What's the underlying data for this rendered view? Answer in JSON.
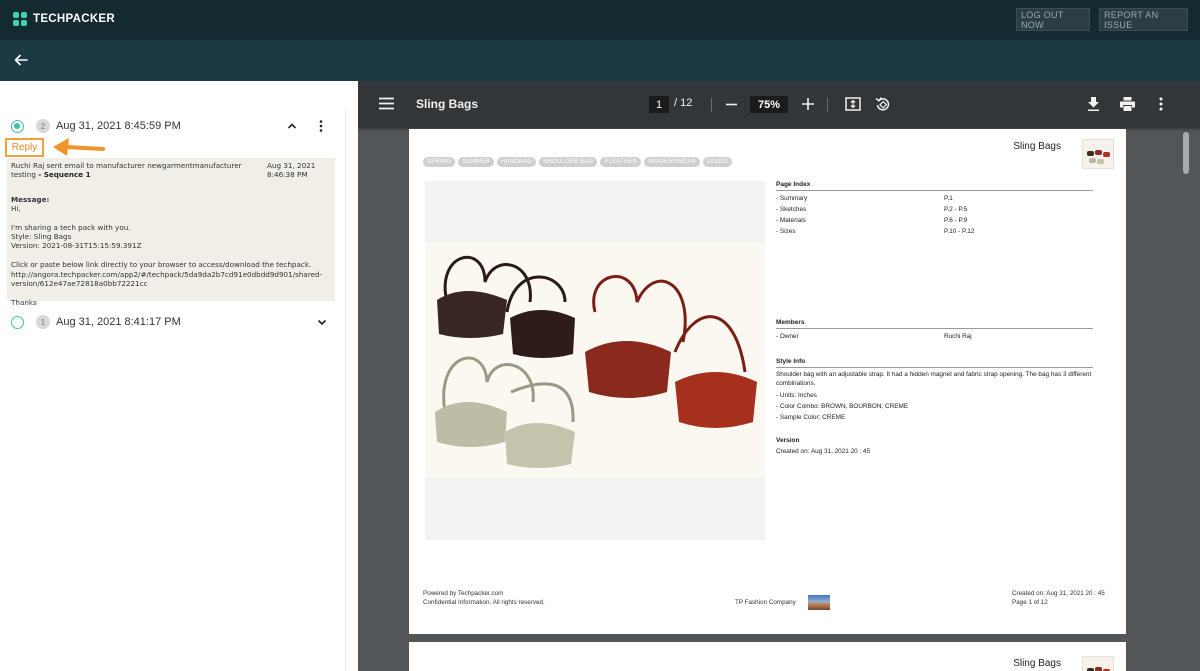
{
  "app": {
    "brand": "TECHPACKER",
    "logout_label": "LOG OUT NOW",
    "report_label": "REPORT AN ISSUE"
  },
  "threads": [
    {
      "count": "2",
      "date": "Aug 31, 2021 8:45:59 PM",
      "expanded": true
    },
    {
      "count": "1",
      "date": "Aug 31, 2021 8:41:17 PM",
      "expanded": false
    }
  ],
  "reply_label": "Reply",
  "email": {
    "summary": "Ruchi Raj sent email to manufacturer newgarmentmanufacturer testing",
    "sequence": "- Sequence 1",
    "stamp": "Aug 31, 2021\n8:46:38 PM",
    "message_label": "Message:",
    "body": "Hi,\n\nI'm sharing a tech pack with you.\nStyle: Sling Bags\nVersion: 2021-08-31T15:15:59.391Z\n\nClick or paste below link directly to your browser to access/download the techpack.\nhttp://angora.techpacker.com/app2/#/techpack/5da9da2b7cd91e0dbdd9d901/shared-version/612e47ae72818a0bb72221cc\n\nThanks"
  },
  "viewer": {
    "doc_title": "Sling Bags",
    "page_current": "1",
    "page_total": "/ 12",
    "zoom": "75%",
    "colors": {
      "toolbar": "#323639",
      "background": "#525659"
    }
  },
  "pdf": {
    "title": "Sling Bags",
    "tags": [
      "SPRING",
      "SUMMER",
      "HANDBAG",
      "SHOULDER BAG",
      "PLEATHER",
      "WOMENSWEAR",
      "201920"
    ],
    "page_index": {
      "heading": "Page Index",
      "rows": [
        {
          "k": "- Summary",
          "v": "P.1"
        },
        {
          "k": "- Sketches",
          "v": "P.2 - P.5"
        },
        {
          "k": "- Materials",
          "v": "P.6 - P.9"
        },
        {
          "k": "- Sizes",
          "v": "P.10 - P.12"
        }
      ]
    },
    "members": {
      "heading": "Members",
      "rows": [
        {
          "k": "- Owner",
          "v": "Ruchi Raj"
        }
      ]
    },
    "style_info": {
      "heading": "Style Info",
      "description": "Shoulder bag with an adjustable strap. It had a hidden magnet and fabric strap opening. The bag has 3 different combinations.",
      "lines": [
        "- Units: Inches",
        "- Color Combo: BROWN, BOURBON, CREME",
        "- Sample Color: CREME"
      ]
    },
    "version": {
      "heading": "Version",
      "created": "Created on: Aug 31, 2021 20 : 45"
    },
    "footer": {
      "powered": "Powered by Techpacker.com",
      "confidential": "Confidential Information. All rights reserved.",
      "company": "TP Fashion Company",
      "created": "Created on: Aug 31, 2021 20 : 45",
      "page": "Page 1 of 12"
    },
    "page2_title": "Sling Bags"
  }
}
